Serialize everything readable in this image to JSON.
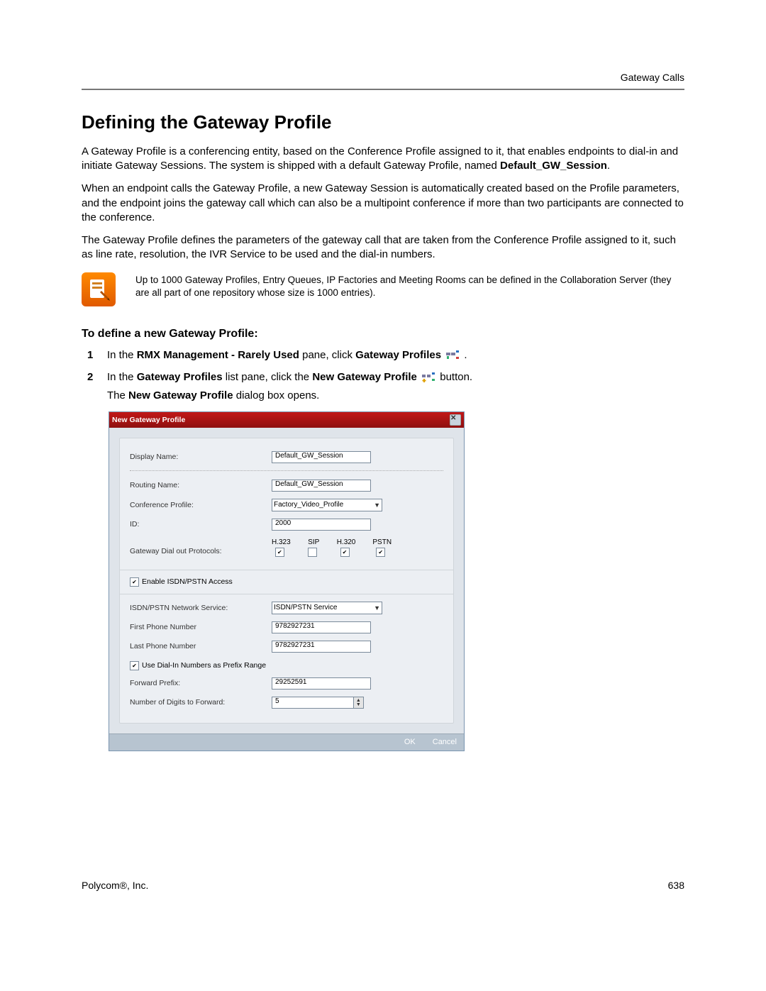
{
  "header": {
    "right": "Gateway Calls"
  },
  "title": "Defining the Gateway Profile",
  "para1_a": "A Gateway Profile is a conferencing entity, based on the Conference Profile assigned to it, that enables endpoints to dial-in and initiate Gateway Sessions. The system is shipped with a default Gateway Profile, named ",
  "para1_b": "Default_GW_Session",
  "para1_c": ".",
  "para2": "When an endpoint calls the Gateway Profile, a new Gateway Session is automatically created based on the Profile parameters, and the endpoint joins the gateway call which can also be a multipoint conference if more than two participants are connected to the conference.",
  "para3": "The Gateway Profile defines the parameters of the gateway call that are taken from the Conference Profile assigned to it, such as line rate, resolution, the IVR Service to be used and the dial-in numbers.",
  "note": "Up to 1000 Gateway Profiles, Entry Queues, IP Factories and Meeting Rooms can be defined in the Collaboration Server (they are all part of one repository whose size is 1000 entries).",
  "subtitle": "To define a new Gateway Profile:",
  "step1": {
    "num": "1",
    "a": "In the ",
    "b": "RMX Management - Rarely Used",
    "c": " pane, click ",
    "d": "Gateway Profiles",
    "e": " ."
  },
  "step2": {
    "num": "2",
    "a": "In the ",
    "b": "Gateway Profiles",
    "c": " list pane, click the ",
    "d": "New Gateway Profile",
    "e": " button.",
    "line2a": "The ",
    "line2b": "New Gateway Profile",
    "line2c": " dialog box opens."
  },
  "dialog": {
    "title": "New Gateway Profile",
    "labels": {
      "display_name": "Display Name:",
      "routing_name": "Routing Name:",
      "conf_profile": "Conference Profile:",
      "id": "ID:",
      "gw_protocols": "Gateway Dial out Protocols:",
      "enable_isdn": "Enable ISDN/PSTN Access",
      "isdn_service": "ISDN/PSTN Network Service:",
      "first_phone": "First Phone Number",
      "last_phone": "Last Phone Number",
      "use_prefix": "Use Dial-In Numbers as Prefix Range",
      "fwd_prefix": "Forward Prefix:",
      "digits_fwd": "Number of Digits to Forward:"
    },
    "values": {
      "display_name": "Default_GW_Session",
      "routing_name": "Default_GW_Session",
      "conf_profile": "Factory_Video_Profile",
      "id": "2000",
      "isdn_service": "ISDN/PSTN Service",
      "first_phone": "9782927231",
      "last_phone": "9782927231",
      "fwd_prefix": "29252591",
      "digits_fwd": "5"
    },
    "protocols": {
      "h323": "H.323",
      "sip": "SIP",
      "h320": "H.320",
      "pstn": "PSTN"
    },
    "buttons": {
      "ok": "OK",
      "cancel": "Cancel"
    }
  },
  "footer": {
    "left": "Polycom®, Inc.",
    "right": "638"
  }
}
